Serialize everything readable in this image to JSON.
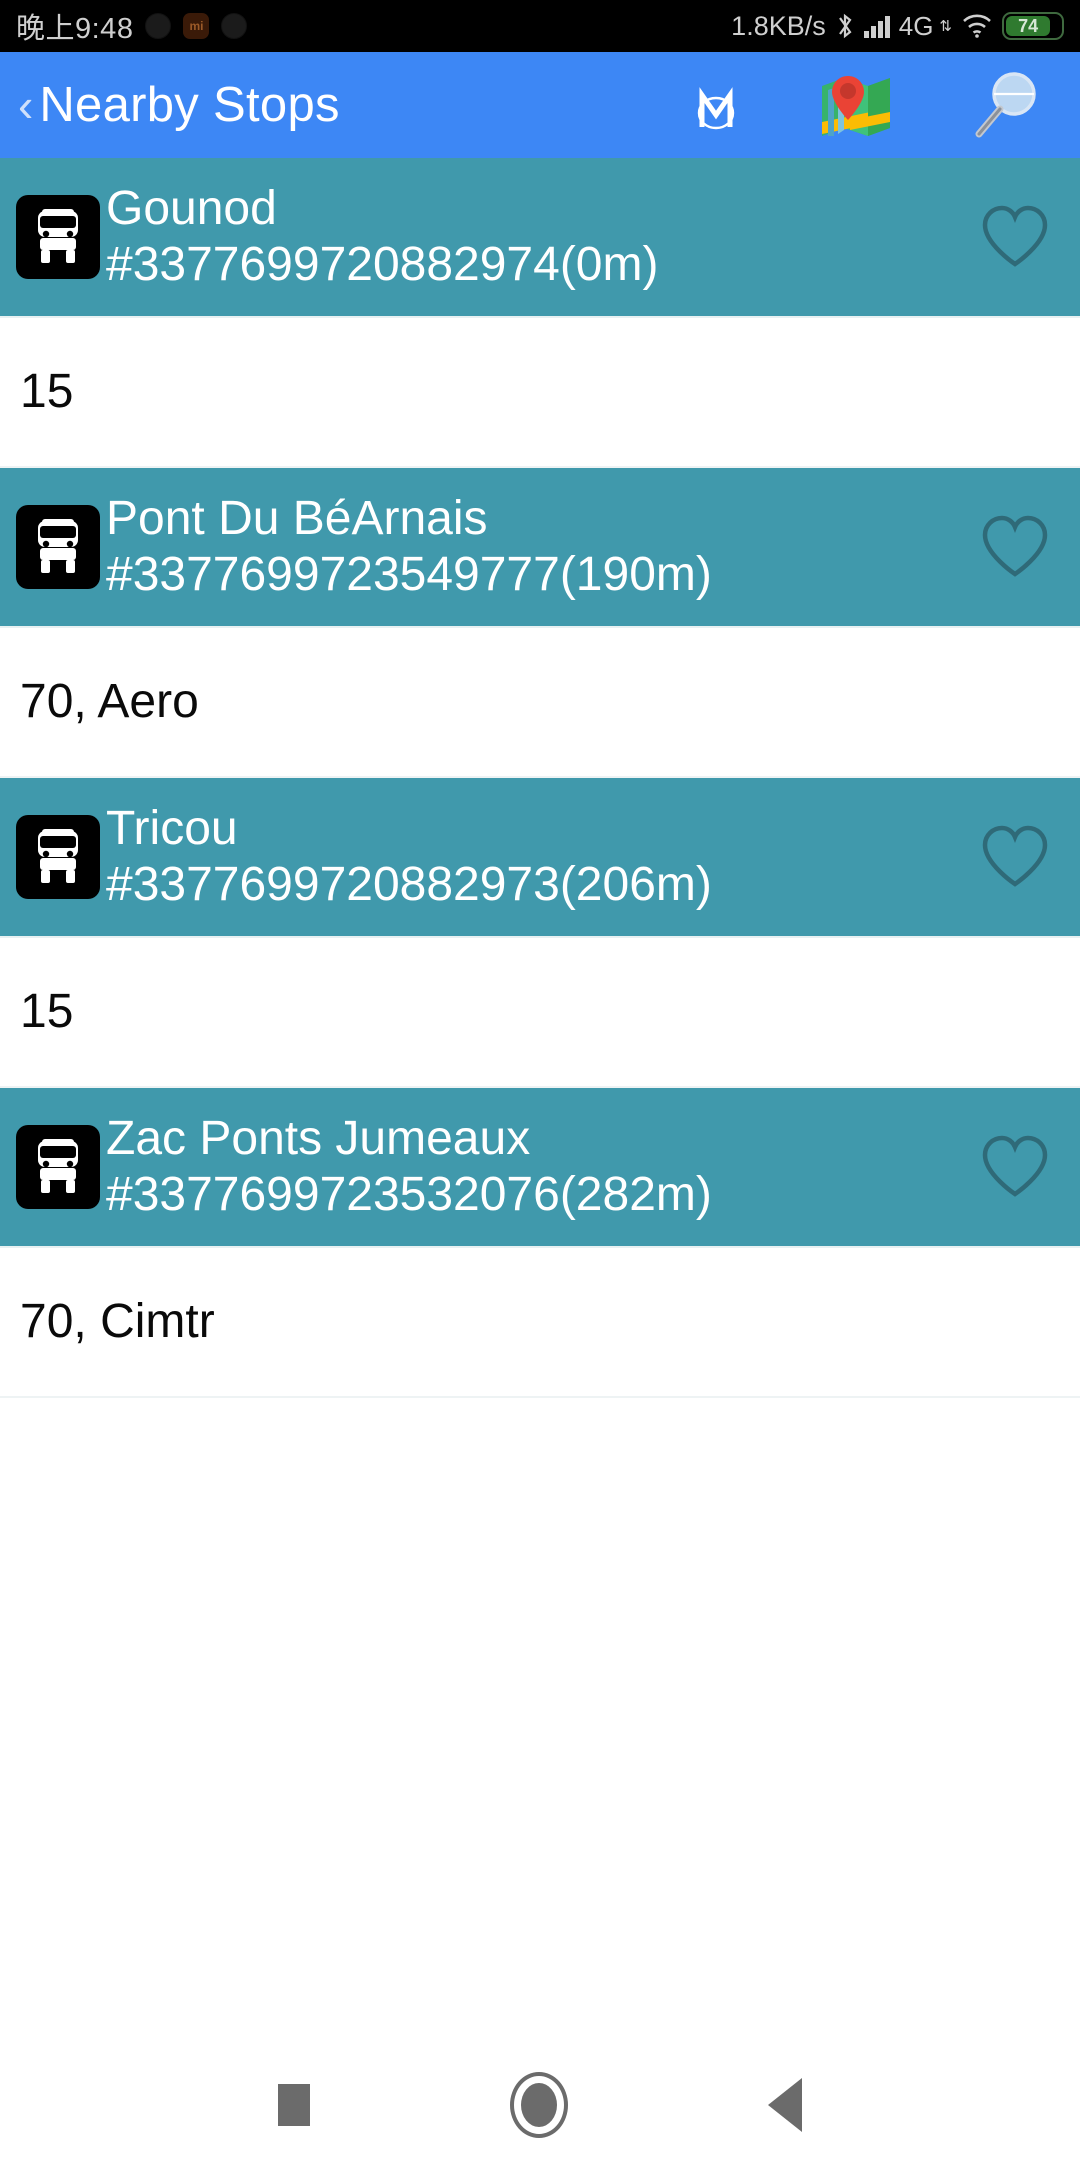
{
  "status_bar": {
    "clock": "晚上9:48",
    "mi_badge": "mi",
    "network_speed": "1.8KB/s",
    "network_type": "4G",
    "battery_level": "74",
    "icons": [
      "bluetooth-icon",
      "signal-bars-icon",
      "wifi-icon",
      "battery-icon"
    ]
  },
  "app_bar": {
    "back_label": "‹",
    "title": "Nearby Stops",
    "actions": [
      {
        "name": "metro-icon",
        "label": "M"
      },
      {
        "name": "map-icon",
        "label": "Map"
      },
      {
        "name": "search-icon",
        "label": "Search"
      }
    ]
  },
  "colors": {
    "app_bar": "#3d87f5",
    "stop_row": "#4099ac",
    "status_bar": "#000000",
    "route_row": "#ffffff",
    "badge": "#000000",
    "battery_green": "#2f7a2f"
  },
  "list": [
    {
      "type": "stop",
      "icon": "bus-icon",
      "name": "Gounod",
      "id_distance": "#3377699720882974(0m)",
      "favorite_icon": "heart-outline-icon",
      "favorited": false
    },
    {
      "type": "route",
      "routes": "15"
    },
    {
      "type": "stop",
      "icon": "bus-icon",
      "name": "Pont Du BéArnais",
      "id_distance": "#3377699723549777(190m)",
      "favorite_icon": "heart-outline-icon",
      "favorited": false
    },
    {
      "type": "route",
      "routes": "70, Aero"
    },
    {
      "type": "stop",
      "icon": "bus-icon",
      "name": "Tricou",
      "id_distance": "#3377699720882973(206m)",
      "favorite_icon": "heart-outline-icon",
      "favorited": false
    },
    {
      "type": "route",
      "routes": "15"
    },
    {
      "type": "stop",
      "icon": "bus-icon",
      "name": "Zac Ponts Jumeaux",
      "id_distance": "#3377699723532076(282m)",
      "favorite_icon": "heart-outline-icon",
      "favorited": false
    },
    {
      "type": "route",
      "routes": "70, Cimtr"
    }
  ],
  "nav_bar": {
    "recents_label": "Recents",
    "home_label": "Home",
    "back_label": "Back"
  }
}
